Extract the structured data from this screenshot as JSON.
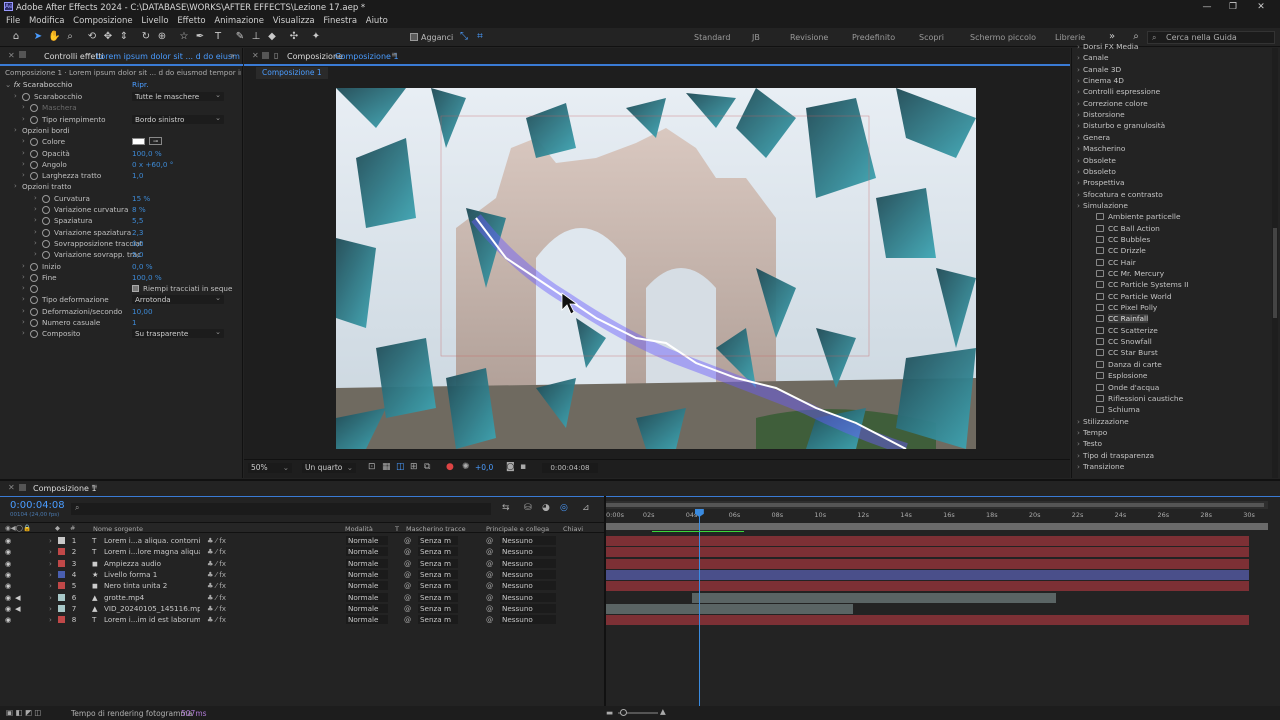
{
  "window": {
    "title": "Adobe After Effects 2024 - C:\\DATABASE\\WORKS\\AFTER EFFECTS\\Lezione 17.aep *"
  },
  "menu": [
    "File",
    "Modifica",
    "Composizione",
    "Livello",
    "Effetto",
    "Animazione",
    "Visualizza",
    "Finestra",
    "Aiuto"
  ],
  "toolbar": {
    "snap_label": "Agganci",
    "workspaces": [
      "Standard",
      "JB",
      "Revisione",
      "Predefinito",
      "Scopri",
      "Schermo piccolo",
      "Librerie"
    ],
    "search_placeholder": "Cerca nella Guida"
  },
  "effects_panel": {
    "tab": "Controlli effetti",
    "tab_layer": "Lorem ipsum dolor sit ... d do eiusm",
    "breadcrumb": "Composizione 1 · Lorem ipsum dolor sit ... d do eiusmod tempor incidi",
    "effect_name": "Scarabocchio",
    "reset_label": "Ripr.",
    "rows": [
      {
        "label": "Scarabocchio",
        "value": "Tutte le maschere",
        "kind": "dd"
      },
      {
        "label": "Maschera",
        "value": "",
        "kind": "dim"
      },
      {
        "label": "Tipo riempimento",
        "value": "Bordo sinistro",
        "kind": "dd"
      },
      {
        "label": "Opzioni bordi",
        "value": "",
        "kind": "group"
      },
      {
        "label": "Colore",
        "value": "",
        "kind": "color"
      },
      {
        "label": "Opacità",
        "value": "100,0 %",
        "kind": "val"
      },
      {
        "label": "Angolo",
        "value": "0 x +60,0 °",
        "kind": "val"
      },
      {
        "label": "Larghezza tratto",
        "value": "1,0",
        "kind": "val"
      },
      {
        "label": "Opzioni tratto",
        "value": "",
        "kind": "group"
      },
      {
        "label": "Curvatura",
        "value": "15 %",
        "kind": "val"
      },
      {
        "label": "Variazione curvatura",
        "value": "8 %",
        "kind": "val"
      },
      {
        "label": "Spaziatura",
        "value": "5,5",
        "kind": "val"
      },
      {
        "label": "Variazione spaziatura",
        "value": "2,3",
        "kind": "val"
      },
      {
        "label": "Sovrapposizione tracciat",
        "value": "0,0",
        "kind": "val"
      },
      {
        "label": "Variazione sovrapp. trac",
        "value": "5,0",
        "kind": "val"
      },
      {
        "label": "Inizio",
        "value": "0,0 %",
        "kind": "val"
      },
      {
        "label": "Fine",
        "value": "100,0 %",
        "kind": "val"
      },
      {
        "label": "",
        "value": "Riempi tracciati in seque",
        "kind": "check"
      },
      {
        "label": "Tipo deformazione",
        "value": "Arrotonda",
        "kind": "dd"
      },
      {
        "label": "Deformazioni/secondo",
        "value": "10,00",
        "kind": "val"
      },
      {
        "label": "Numero casuale",
        "value": "1",
        "kind": "val"
      },
      {
        "label": "Composito",
        "value": "Su trasparente",
        "kind": "dd"
      }
    ]
  },
  "composition": {
    "tab": "Composizione",
    "tab_name": "Composizione 1",
    "sub_tab": "Composizione 1",
    "zoom": "50%",
    "resolution": "Un quarto",
    "exposure": "+0,0",
    "timecode": "0:00:04:08"
  },
  "effects_presets": {
    "groups_top": [
      "Dorsi FX Media",
      "Canale",
      "Canale 3D",
      "Cinema 4D",
      "Controlli espressione",
      "Correzione colore",
      "Distorsione",
      "Disturbo e granulosità",
      "Genera",
      "Mascherino",
      "Obsolete",
      "Obsoleto",
      "Prospettiva",
      "Sfocatura e contrasto",
      "Simulazione"
    ],
    "simulation_items": [
      "Ambiente particelle",
      "CC Ball Action",
      "CC Bubbles",
      "CC Drizzle",
      "CC Hair",
      "CC Mr. Mercury",
      "CC Particle Systems II",
      "CC Particle World",
      "CC Pixel Polly",
      "CC Rainfall",
      "CC Scatterize",
      "CC Snowfall",
      "CC Star Burst",
      "Danza di carte",
      "Esplosione",
      "Onde d'acqua",
      "Riflessioni caustiche",
      "Schiuma"
    ],
    "selected": "CC Rainfall",
    "groups_bottom": [
      "Stilizzazione",
      "Tempo",
      "Testo",
      "Tipo di trasparenza",
      "Transizione"
    ]
  },
  "timeline": {
    "tab": "Composizione 1",
    "timecode": "0:00:04:08",
    "frame_info": "00104 (24,00 fps)",
    "columns": {
      "source": "Nome sorgente",
      "mode": "Modalità",
      "t": "T",
      "matte": "Mascherino tracce",
      "parent": "Principale e collega",
      "keys": "Chiavi"
    },
    "ruler": [
      "0:00s",
      "02s",
      "04s",
      "06s",
      "08s",
      "10s",
      "12s",
      "14s",
      "16s",
      "18s",
      "20s",
      "22s",
      "24s",
      "26s",
      "28s",
      "30s"
    ],
    "playhead_seconds": 4.33,
    "layers": [
      {
        "num": "1",
        "type": "T",
        "name": "Lorem i...a aliqua. contorni",
        "color": "#c8c8c8",
        "mode": "Normale",
        "matte": "Senza m",
        "parent": "Nessuno",
        "bar_color": "#7d3035",
        "bar_start": 0,
        "bar_end": 30
      },
      {
        "num": "2",
        "type": "T",
        "name": "Lorem i...lore magna aliqua.",
        "color": "#c04848",
        "mode": "Normale",
        "matte": "Senza m",
        "parent": "Nessuno",
        "bar_color": "#7d3035",
        "bar_start": 0,
        "bar_end": 30
      },
      {
        "num": "3",
        "type": "◼",
        "name": "Ampiezza audio",
        "color": "#c04848",
        "mode": "Normale",
        "matte": "Senza m",
        "parent": "Nessuno",
        "bar_color": "#7d3035",
        "bar_start": 0,
        "bar_end": 30
      },
      {
        "num": "4",
        "type": "★",
        "name": "Livello forma 1",
        "color": "#4a5fb0",
        "mode": "Normale",
        "matte": "Senza m",
        "parent": "Nessuno",
        "bar_color": "#4a4f8a",
        "bar_start": 0,
        "bar_end": 30
      },
      {
        "num": "5",
        "type": "◼",
        "name": "Nero tinta unita 2",
        "color": "#c04848",
        "mode": "Normale",
        "matte": "Senza m",
        "parent": "Nessuno",
        "bar_color": "#7d3035",
        "bar_start": 0,
        "bar_end": 30
      },
      {
        "num": "6",
        "type": "▲",
        "name": "grotte.mp4",
        "color": "#a8c8c8",
        "mode": "Normale",
        "matte": "Senza m",
        "parent": "Nessuno",
        "bar_color": "#5a6464",
        "bar_start": 4,
        "bar_end": 21
      },
      {
        "num": "7",
        "type": "▲",
        "name": "VID_20240105_145116.mp4",
        "color": "#a8c8c8",
        "mode": "Normale",
        "matte": "Senza m",
        "parent": "Nessuno",
        "bar_color": "#5a6464",
        "bar_start": 0,
        "bar_end": 11.5
      },
      {
        "num": "8",
        "type": "T",
        "name": "Lorem i...im id est laborum.",
        "color": "#c04848",
        "mode": "Normale",
        "matte": "Senza m",
        "parent": "Nessuno",
        "bar_color": "#7d3035",
        "bar_start": 0,
        "bar_end": 30
      }
    ]
  },
  "status": {
    "label": "Tempo di rendering fotogramma",
    "value": "507ms"
  }
}
